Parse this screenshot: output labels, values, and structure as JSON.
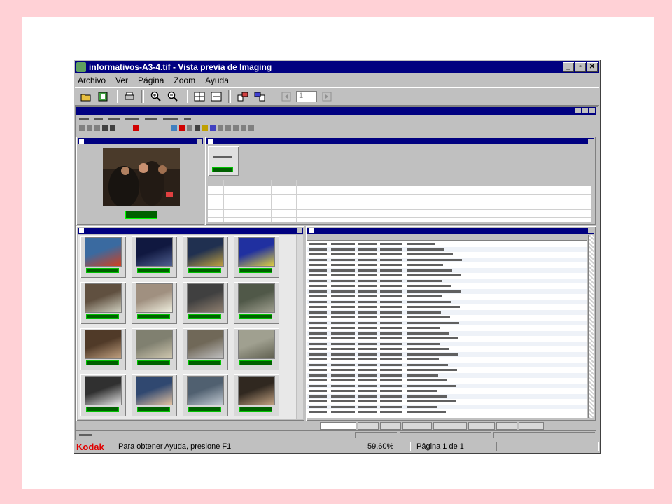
{
  "window": {
    "title": "informativos-A3-4.tif - Vista previa de Imaging",
    "buttons": {
      "minimize": "_",
      "maximize": "▫",
      "close": "✕"
    }
  },
  "menu": [
    "Archivo",
    "Ver",
    "Página",
    "Zoom",
    "Ayuda"
  ],
  "toolbar": {
    "page_field": "1"
  },
  "status": {
    "brand": "Kodak",
    "help": "Para obtener Ayuda, presione F1",
    "zoom": "59,60%",
    "page": "Página 1 de 1"
  },
  "colors": {
    "title_bar": "#000080",
    "timecode": "#006000",
    "brand": "#e00000",
    "frame": "#ffd1d6"
  },
  "icons": [
    "open-folder-icon",
    "scan-icon",
    "print-icon",
    "zoom-in-icon",
    "zoom-out-icon",
    "fit-page-icon",
    "fit-width-icon",
    "rotate-left-icon",
    "rotate-right-icon",
    "previous-page-icon",
    "next-page-icon"
  ]
}
